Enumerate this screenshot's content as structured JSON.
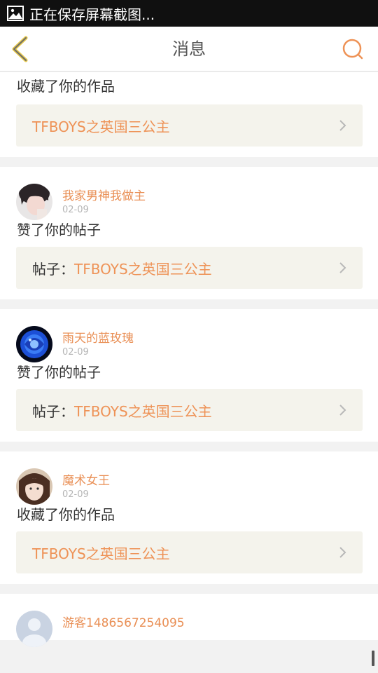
{
  "status_bar": {
    "icon": "image-icon",
    "text": "正在保存屏幕截图..."
  },
  "header": {
    "title": "消息",
    "back_icon": "chevron-left-icon",
    "search_icon": "search-icon"
  },
  "colors": {
    "accent": "#ee9256",
    "link_bg": "#f4f3ec"
  },
  "messages": [
    {
      "action": "收藏了你的作品",
      "link_prefix": "",
      "link_text": "TFBOYS之英国三公主"
    },
    {
      "user": "我家男神我做主",
      "date": "02-09",
      "action": "赞了你的帖子",
      "link_prefix": "帖子：",
      "link_text": "TFBOYS之英国三公主"
    },
    {
      "user": "雨天的蓝玫瑰",
      "date": "02-09",
      "action": "赞了你的帖子",
      "link_prefix": "帖子：",
      "link_text": "TFBOYS之英国三公主"
    },
    {
      "user": "魔术女王",
      "date": "02-09",
      "action": "收藏了你的作品",
      "link_prefix": "",
      "link_text": "TFBOYS之英国三公主"
    },
    {
      "user": "游客1486567254095"
    }
  ]
}
